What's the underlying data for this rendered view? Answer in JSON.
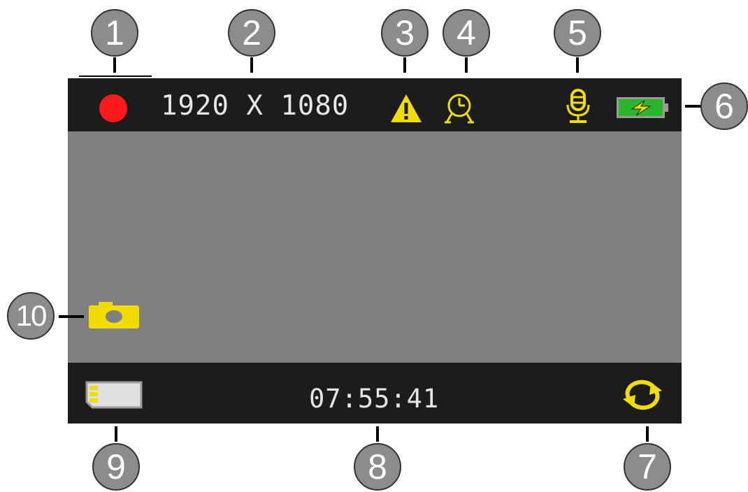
{
  "status_bar": {
    "resolution": "1920 X 1080"
  },
  "bottom_bar": {
    "timer": "07:55:41"
  },
  "callouts": [
    "1",
    "2",
    "3",
    "4",
    "5",
    "6",
    "7",
    "8",
    "9",
    "10"
  ],
  "icons": {
    "recording": "record-dot-icon",
    "warning": "warning-icon",
    "timelapse": "clock-icon",
    "microphone": "microphone-icon",
    "battery": "battery-charging-icon",
    "loop": "loop-recording-icon",
    "sd_card": "sd-card-icon",
    "camera": "camera-icon"
  },
  "colors": {
    "record": "#ff1a1a",
    "icon_yellow": "#f2dc00",
    "battery_green": "#2bb52b",
    "bar_background": "#1c1c1c",
    "screen_background": "#808080"
  }
}
